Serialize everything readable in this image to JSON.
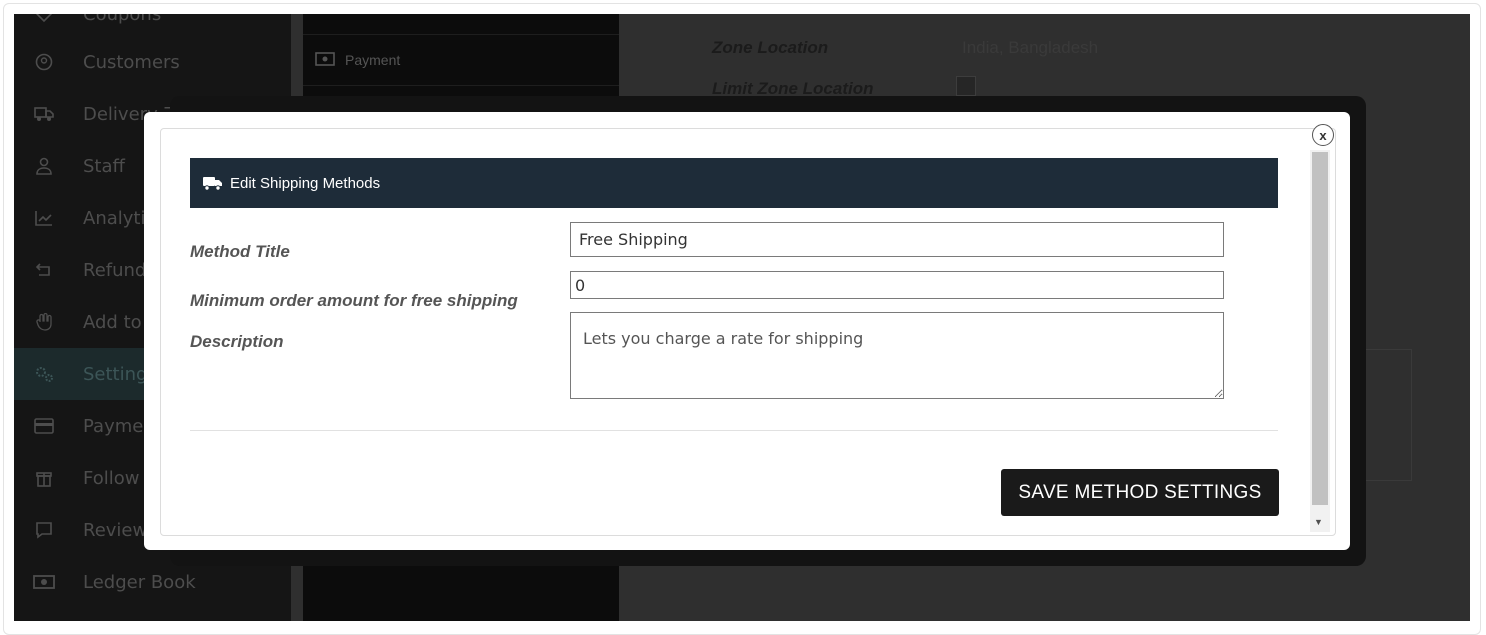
{
  "sidebar": {
    "items": [
      {
        "label": "Coupons",
        "icon": "tag-icon"
      },
      {
        "label": "Customers",
        "icon": "user-circle-icon"
      },
      {
        "label": "Delivery Zone",
        "icon": "truck-icon"
      },
      {
        "label": "Staff",
        "icon": "user-icon"
      },
      {
        "label": "Analytics",
        "icon": "chart-line-icon"
      },
      {
        "label": "Refund",
        "icon": "refund-icon"
      },
      {
        "label": "Add to",
        "icon": "hand-icon"
      },
      {
        "label": "Settings",
        "icon": "gears-icon",
        "active": true
      },
      {
        "label": "Payment",
        "icon": "credit-card-icon"
      },
      {
        "label": "Follow",
        "icon": "gift-icon"
      },
      {
        "label": "Review",
        "icon": "comment-icon"
      },
      {
        "label": "Ledger Book",
        "icon": "money-icon"
      }
    ]
  },
  "settings_nav": {
    "items": [
      {
        "label": "Payment",
        "icon": "money-icon"
      }
    ]
  },
  "zone": {
    "location_label": "Zone Location",
    "location_value": "India, Bangladesh",
    "limit_label": "Limit Zone Location"
  },
  "modal": {
    "title": "Edit Shipping Methods",
    "title_icon": "truck-icon",
    "close_label": "x",
    "fields": {
      "method_title_label": "Method Title",
      "method_title_value": "Free Shipping",
      "min_amount_label": "Minimum order amount for free shipping",
      "min_amount_value": "0",
      "description_label": "Description",
      "description_value": "Lets you charge a rate for shipping"
    },
    "save_label": "SAVE METHOD SETTINGS"
  },
  "colors": {
    "header_bg": "#1e2c39",
    "button_bg": "#1a1a1a",
    "overlay": "#2f2f2f",
    "sidebar_bg": "#151515"
  }
}
